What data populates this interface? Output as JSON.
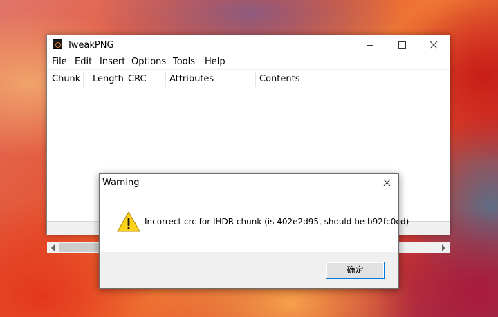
{
  "window": {
    "title": "TweakPNG",
    "menu": [
      "File",
      "Edit",
      "Insert",
      "Options",
      "Tools",
      "Help"
    ],
    "columns": [
      "Chunk",
      "Length",
      "CRC",
      "Attributes",
      "Contents"
    ],
    "controls": {
      "minimize": "minimize-icon",
      "maximize": "maximize-icon",
      "close": "close-icon"
    }
  },
  "dialog": {
    "title": "Warning",
    "message": "Incorrect crc for IHDR chunk (is 402e2d95, should be b92fc0cd)",
    "ok_label": "确定",
    "icon": "warning-icon",
    "accent_color": "#0078d7",
    "icon_color": "#ffd21a"
  }
}
